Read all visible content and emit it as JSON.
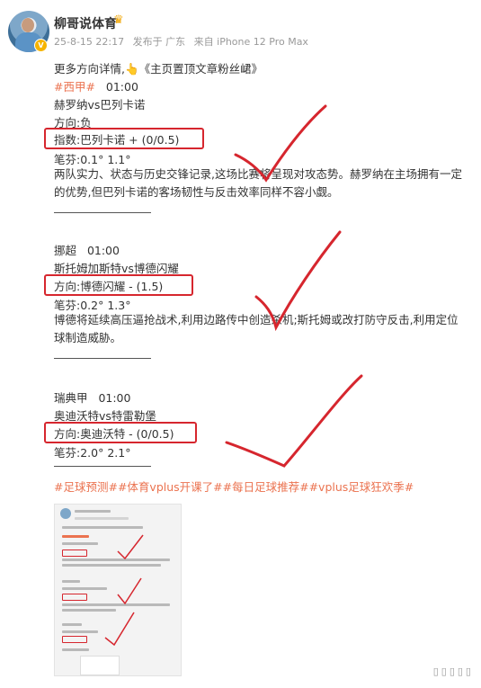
{
  "author": {
    "name": "柳哥说体育",
    "badge": "♛",
    "meta": {
      "date": "25-8-15 22:17",
      "location": "发布于 广东",
      "device": "来自 iPhone 12 Pro Max"
    }
  },
  "intro": {
    "text": "更多方向详情,",
    "emoji": "👆",
    "link": "《主页置顶文章粉丝峮》"
  },
  "matches": [
    {
      "league_tag": "#西甲#",
      "time": "01:00",
      "teams": "赫罗纳vs巴列卡诺",
      "direction": "方向:负",
      "index": "指数:巴列卡诺 + (0/0.5)",
      "odds": "笔芬:0.1° 1.1°",
      "analysis": "两队实力、状态与历史交锋记录,这场比赛将呈现对攻态势。赫罗纳在主场拥有一定的优势,但巴列卡诺的客场韧性与反击效率同样不容小觑。"
    },
    {
      "league": "挪超",
      "time": "01:00",
      "teams": "斯托姆加斯特vs博德闪耀",
      "direction": "方向:博德闪耀 - (1.5)",
      "odds": "笔芬:0.2° 1.3°",
      "analysis": "博德将延续高压逼抢战术,利用边路传中创造杀机;斯托姆或改打防守反击,利用定位球制造威胁。"
    },
    {
      "league": "瑞典甲",
      "time": "01:00",
      "teams": "奥迪沃特vs特雷勒堡",
      "direction": "方向:奥迪沃特 - (0/0.5)",
      "odds": "笔芬:2.0° 2.1°"
    }
  ],
  "hashtags": "#足球预测##体育vplus开课了##每日足球推荐##vplus足球狂欢季#",
  "divider": "—————————",
  "colors": {
    "highlight_box": "#d6262e",
    "tag": "#eb7350",
    "meta": "#999999"
  }
}
